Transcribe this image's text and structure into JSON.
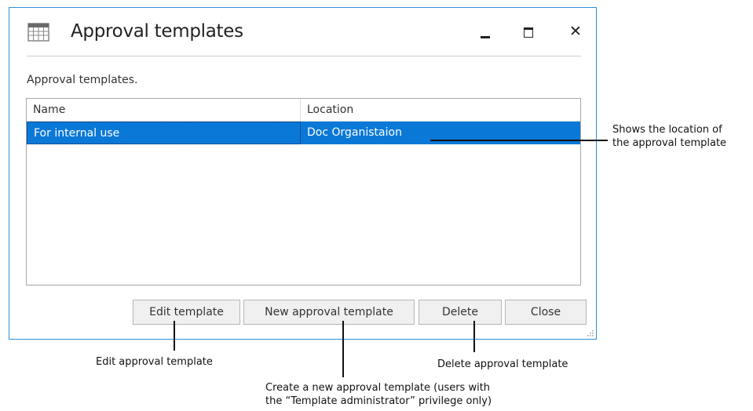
{
  "dialog": {
    "title": "Approval templates",
    "description": "Approval templates.",
    "icon": "calendar-grid-icon"
  },
  "window_controls": {
    "close_glyph": "✕"
  },
  "list": {
    "columns": [
      "Name",
      "Location"
    ],
    "rows": [
      {
        "name": "For internal use",
        "location": "Doc Organistaion",
        "selected": true
      }
    ],
    "selection_color": "#0a78d7"
  },
  "buttons": {
    "edit": "Edit template",
    "new": "New approval template",
    "delete": "Delete",
    "close": "Close"
  },
  "annotations": {
    "location_line1": "Shows the location of",
    "location_line2": "the approval template",
    "edit": "Edit approval template",
    "delete": "Delete approval template",
    "new_line1": "Create a new approval template (users with",
    "new_line2": "the “Template administrator” privilege only)"
  },
  "colors": {
    "window_border": "#2b8fd9"
  }
}
